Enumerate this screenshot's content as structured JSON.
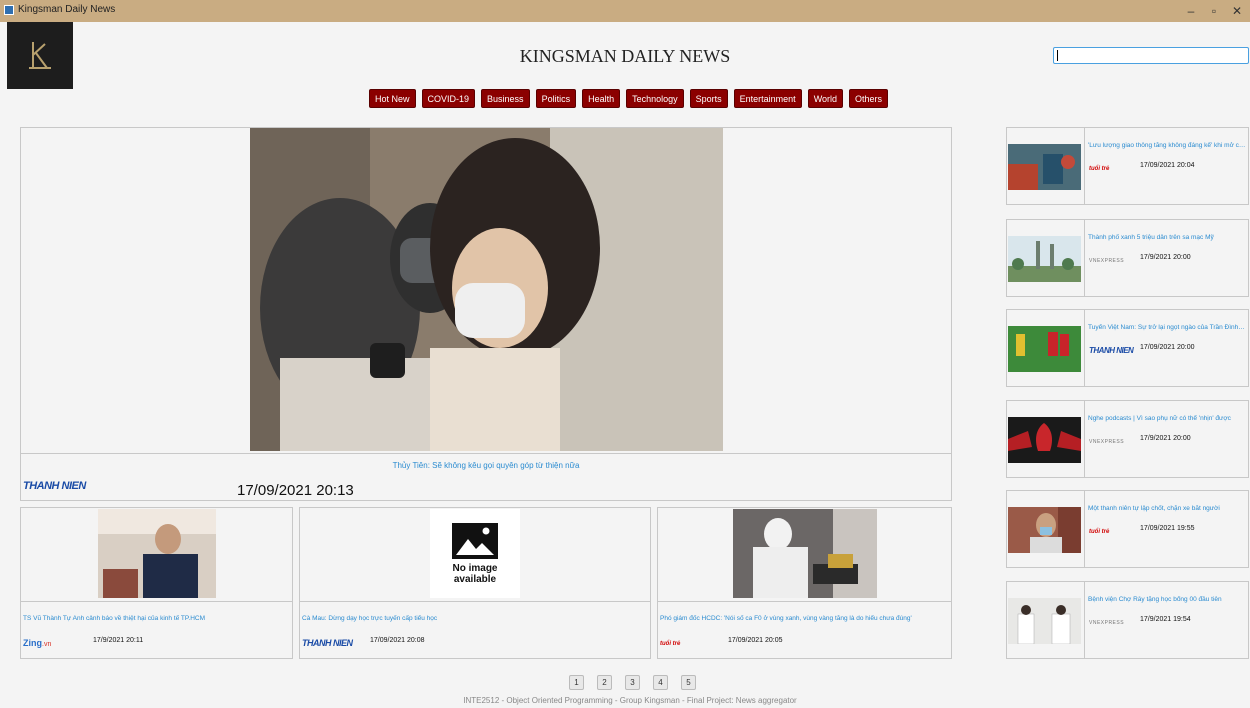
{
  "window": {
    "title": "Kingsman Daily News",
    "minimize": "–",
    "maximize": "▫",
    "close": "✕"
  },
  "header": {
    "logo_letter": "𝕂",
    "title": "KINGSMAN DAILY NEWS",
    "search_value": ""
  },
  "categories": [
    "Hot New",
    "COVID-19",
    "Business",
    "Politics",
    "Health",
    "Technology",
    "Sports",
    "Entertainment",
    "World",
    "Others"
  ],
  "featured": {
    "title": "Thủy Tiên: Sẽ không kêu gọi quyên góp từ thiện nữa",
    "source": "THANH NIEN",
    "time": "17/09/2021 20:13"
  },
  "articles": [
    {
      "title": "TS Vũ Thành Tự Anh cảnh báo về thiệt hại của kinh tế TP.HCM",
      "source": "Zing",
      "source_suffix": ".vn",
      "time": "17/9/2021 20:11"
    },
    {
      "title": "Cà Mau: Dừng dạy học trực tuyến cấp tiểu học",
      "source": "THANH NIEN",
      "time": "17/09/2021 20:08",
      "image_placeholder": "No image available"
    },
    {
      "title": "Phó giám đốc HCDC: 'Nói số ca F0 ở vùng xanh, vùng vàng tăng là do hiểu chưa đúng'",
      "source": "tuổi trẻ",
      "time": "17/09/2021 20:05"
    }
  ],
  "sidebar": [
    {
      "title": "'Lưu lượng giao thông tăng không đáng kể' khi mở cửa trở lại",
      "source": "tuổi trẻ",
      "time": "17/09/2021 20:04"
    },
    {
      "title": "Thành phố xanh 5 triệu dân trên sa mạc Mỹ",
      "source": "VNEXPRESS",
      "time": "17/9/2021 20:00"
    },
    {
      "title": "Tuyển Việt Nam: Sự trở lại ngọt ngào của Trần Đình Trọng",
      "source": "THANH NIEN",
      "time": "17/09/2021 20:00"
    },
    {
      "title": "Nghe podcasts | Vì sao phụ nữ có thể 'nhịn' được",
      "source": "VNEXPRESS",
      "time": "17/9/2021 20:00"
    },
    {
      "title": "Một thanh niên tự lập chốt, chặn xe bắt người",
      "source": "tuổi trẻ",
      "time": "17/09/2021 19:55"
    },
    {
      "title": "Bệnh viện Chợ Rẫy tặng học bổng 00 đầu tiên",
      "source": "VNEXPRESS",
      "time": "17/9/2021 19:54"
    }
  ],
  "pager": [
    "1",
    "2",
    "3",
    "4",
    "5"
  ],
  "footer": "INTE2512 - Object Oriented Programming - Group Kingsman - Final Project: News aggregator"
}
